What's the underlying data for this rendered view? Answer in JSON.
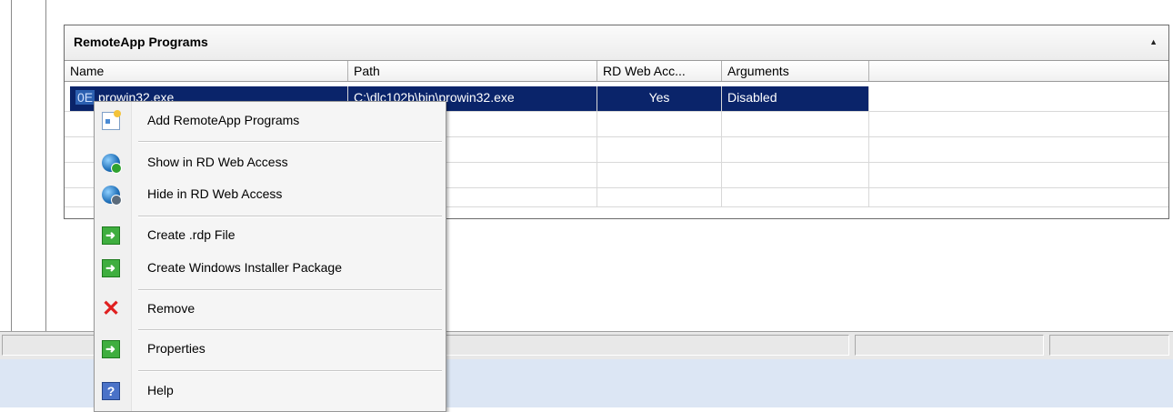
{
  "panel": {
    "title": "RemoteApp Programs",
    "collapse_glyph": "▲",
    "columns": [
      "Name",
      "Path",
      "RD Web Acc...",
      "Arguments"
    ],
    "rows": [
      {
        "icon_text": "0E",
        "name": "prowin32.exe",
        "path": "C:\\dlc102b\\bin\\prowin32.exe",
        "rd_web_access": "Yes",
        "arguments": "Disabled",
        "selected": true
      }
    ]
  },
  "context_menu": {
    "items": [
      {
        "label": "Add RemoteApp Programs",
        "icon": "add-remoteapp-icon"
      },
      {
        "label": "Show in RD Web Access",
        "icon": "globe-show-icon"
      },
      {
        "label": "Hide in RD Web Access",
        "icon": "globe-hide-icon"
      },
      {
        "label": "Create .rdp File",
        "icon": "green-arrow-icon"
      },
      {
        "label": "Create Windows Installer Package",
        "icon": "green-arrow-icon"
      },
      {
        "label": "Remove",
        "icon": "remove-x-icon"
      },
      {
        "label": "Properties",
        "icon": "green-arrow-icon"
      },
      {
        "label": "Help",
        "icon": "help-icon"
      }
    ]
  },
  "colors": {
    "selection": "#0a246a",
    "background_bottom": "#dce6f4"
  }
}
